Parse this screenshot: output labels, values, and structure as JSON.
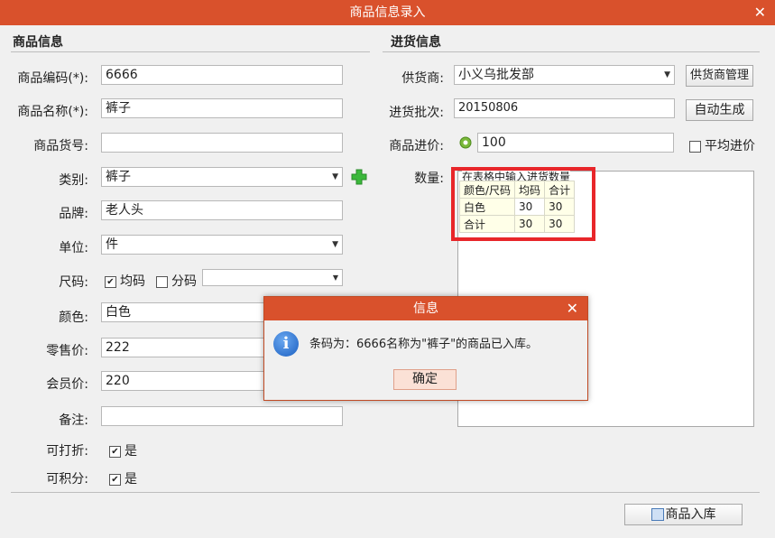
{
  "window": {
    "title": "商品信息录入",
    "close": "✕"
  },
  "product": {
    "section_title": "商品信息",
    "code_label": "商品编码(*):",
    "code_value": "6666",
    "name_label": "商品名称(*):",
    "name_value": "裤子",
    "sku_label": "商品货号:",
    "sku_value": "",
    "category_label": "类别:",
    "category_value": "裤子",
    "brand_label": "品牌:",
    "brand_value": "老人头",
    "unit_label": "单位:",
    "unit_value": "件",
    "size_label": "尺码:",
    "size_uniform_label": "均码",
    "size_split_label": "分码",
    "color_label": "颜色:",
    "color_value": "白色",
    "retail_label": "零售价:",
    "retail_value": "222",
    "member_label": "会员价:",
    "member_value": "220",
    "note_label": "备注:",
    "note_value": "",
    "discount_label": "可打折:",
    "discount_check": "是",
    "points_label": "可积分:",
    "points_check": "是"
  },
  "purchase": {
    "section_title": "进货信息",
    "supplier_label": "供货商:",
    "supplier_value": "小义乌批发部",
    "supplier_btn": "供货商管理",
    "batch_label": "进货批次:",
    "batch_value": "20150806",
    "batch_btn": "自动生成",
    "cost_label": "商品进价:",
    "cost_value": "100",
    "avg_cost_label": "平均进价",
    "qty_label": "数量:",
    "grid_hint": "在表格中输入进货数量",
    "grid_headers": [
      "颜色/尺码",
      "均码",
      "合计"
    ],
    "grid_rows": [
      [
        "白色",
        "30",
        "30"
      ],
      [
        "合计",
        "30",
        "30"
      ]
    ]
  },
  "dialog": {
    "title": "信息",
    "close": "✕",
    "message": "条码为：6666名称为\"裤子\"的商品已入库。",
    "ok": "确定"
  },
  "footer": {
    "submit": "商品入库"
  },
  "colors": {
    "titlebar": "#d9512c",
    "highlight": "#e8262a",
    "add_icon": "#3bb83b"
  }
}
